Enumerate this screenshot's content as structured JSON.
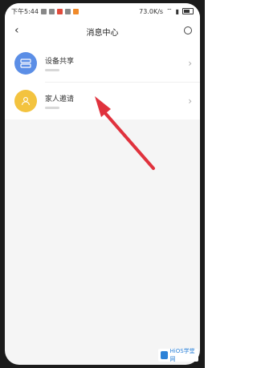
{
  "status_bar": {
    "time": "下午5:44",
    "network_speed": "73.0K/s"
  },
  "header": {
    "back_icon": "‹",
    "title": "消息中心"
  },
  "rows": [
    {
      "title": "设备共享",
      "avatar_color": "#5b8ee6"
    },
    {
      "title": "家人邀请",
      "avatar_color": "#f3c33f"
    }
  ],
  "watermark": {
    "text": "HiOS学堂网"
  },
  "colors": {
    "arrow": "#e0323d",
    "background": "#f5f5f5"
  }
}
